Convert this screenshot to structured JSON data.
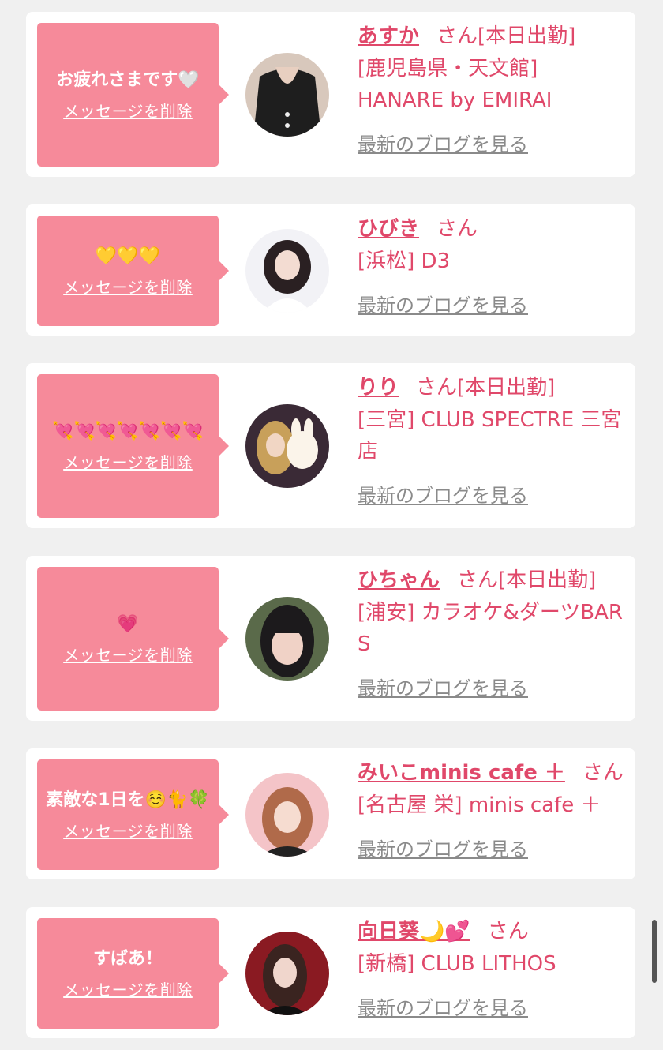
{
  "delete_label": "メッセージを削除",
  "blog_label": "最新のブログを見る",
  "san_label": "さん",
  "cards": [
    {
      "message": "お疲れさまです🤍",
      "name": "あすか",
      "status": "[本日出勤]",
      "shop": "[鹿児島県・天文館] HANARE by EMIRAI"
    },
    {
      "message": "💛💛💛",
      "name": "ひびき",
      "status": "",
      "shop": "[浜松] D3"
    },
    {
      "message": "💘💘💘💘💘💘💘",
      "name": "りり",
      "status": "[本日出勤]",
      "shop": "[三宮] CLUB SPECTRE 三宮店"
    },
    {
      "message": "💗",
      "name": "ひちゃん",
      "status": "[本日出勤]",
      "shop": "[浦安] カラオケ&ダーツBAR S"
    },
    {
      "message": "素敵な1日を☺️🐈🍀",
      "name": "みいこminis cafe ＋",
      "status": "",
      "shop": "[名古屋 栄] minis cafe ＋"
    },
    {
      "message": "すばあ！",
      "name": "向日葵🌙💕",
      "status": "",
      "shop": "[新橋] CLUB LITHOS"
    }
  ],
  "colors": {
    "accent": "#e0486a",
    "bubble": "#f68a9a",
    "link_gray": "#8a8a8a"
  }
}
